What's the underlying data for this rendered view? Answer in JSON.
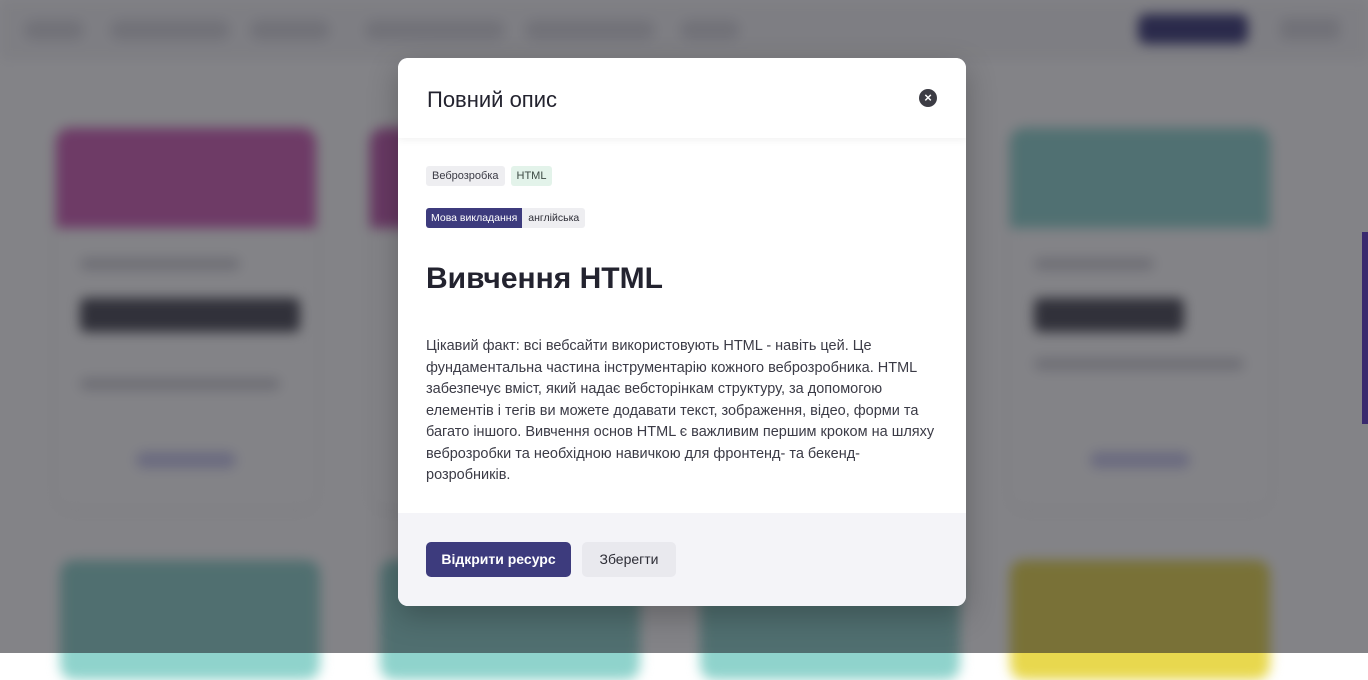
{
  "modal": {
    "title": "Повний опис",
    "close_icon": "close-icon",
    "tags": [
      "Веброзробка",
      "HTML"
    ],
    "language_label": "Мова викладання",
    "language_value": "англійська",
    "course_title": "Вивчення HTML",
    "description": "Цікавий факт: всі вебсайти використовують HTML - навіть цей. Це фундаментальна частина інструментарію кожного веброзробника. HTML забезпечує вміст, який надає вебсторінкам структуру, за допомогою елементів і тегів ви можете додавати текст, зображення, відео, форми та багато іншого. Вивчення основ HTML є важливим першим кроком на шляху веброзробки та необхідною навичкою для фронтенд- та бекенд-розробників.",
    "open_button": "Відкрити ресурс",
    "save_button": "Зберегти"
  },
  "colors": {
    "primary": "#3d3b7d",
    "overlay": "rgba(30,30,36,0.55)",
    "tag_grey": "#eeeef1",
    "tag_green": "#e3f3ea"
  }
}
